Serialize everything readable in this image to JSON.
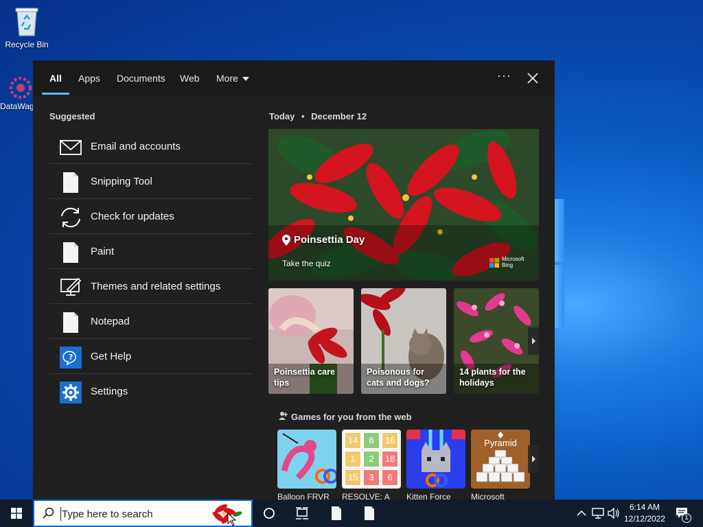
{
  "desktop": {
    "icons": [
      {
        "label": "Recycle Bin",
        "icon": "recycle-bin-icon"
      },
      {
        "label": "DataWag",
        "icon": "datawag-app-icon"
      }
    ]
  },
  "search_panel": {
    "tabs": [
      {
        "label": "All",
        "active": true
      },
      {
        "label": "Apps"
      },
      {
        "label": "Documents"
      },
      {
        "label": "Web"
      },
      {
        "label": "More"
      }
    ],
    "more_options": "···",
    "suggested": {
      "title": "Suggested",
      "items": [
        {
          "label": "Email and accounts",
          "icon": "mail-icon"
        },
        {
          "label": "Snipping Tool",
          "icon": "document-icon"
        },
        {
          "label": "Check for updates",
          "icon": "sync-icon"
        },
        {
          "label": "Paint",
          "icon": "document-icon"
        },
        {
          "label": "Themes and related settings",
          "icon": "personalize-icon"
        },
        {
          "label": "Notepad",
          "icon": "document-icon"
        },
        {
          "label": "Get Help",
          "icon": "get-help-icon"
        },
        {
          "label": "Settings",
          "icon": "gear-icon"
        }
      ]
    },
    "today": {
      "label": "Today",
      "separator": "•",
      "date": "December 12",
      "hero": {
        "title": "Poinsettia Day",
        "subtitle": "Take the quiz",
        "badge_line1": "Microsoft",
        "badge_line2": "Bing"
      },
      "cards": [
        {
          "label": "Poinsettia care tips"
        },
        {
          "label": "Poisonous for cats and dogs?"
        },
        {
          "label": "14 plants for the holidays"
        }
      ]
    },
    "games": {
      "title": "Games for you from the web",
      "items": [
        {
          "label": "Balloon FRVR"
        },
        {
          "label": "RESOLVE: A"
        },
        {
          "label": "Kitten Force"
        },
        {
          "label": "Microsoft"
        }
      ],
      "resolve_tiles": [
        "14",
        "8",
        "16",
        "1",
        "2",
        "18",
        "15",
        "3",
        "6"
      ],
      "pyramid_label": "Pyramid"
    }
  },
  "taskbar": {
    "search_placeholder": "Type here to search",
    "clock_time": "6:14 AM",
    "clock_date": "12/12/2022",
    "notification_count": "1"
  },
  "colors": {
    "accent": "#4cc2ff",
    "panel_bg": "#202020",
    "taskbar_bg": "#101c2c"
  }
}
